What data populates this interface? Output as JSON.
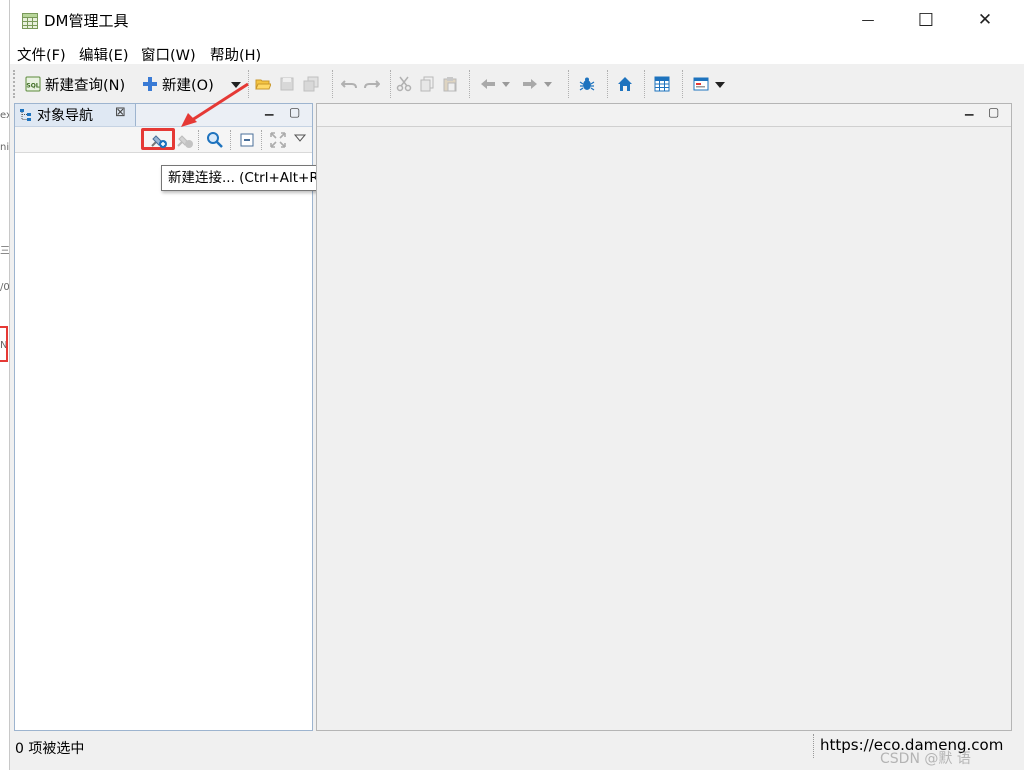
{
  "window": {
    "title": "DM管理工具",
    "controls": {
      "minimize": "—",
      "maximize": "☐",
      "close": "✕"
    }
  },
  "menu": [
    {
      "label": "文件(F)",
      "mnemonic": "F"
    },
    {
      "label": "编辑(E)",
      "mnemonic": "E"
    },
    {
      "label": "窗口(W)",
      "mnemonic": "W"
    },
    {
      "label": "帮助(H)",
      "mnemonic": "H"
    }
  ],
  "toolbar": {
    "new_query_label": "新建查询(N)",
    "new_label": "新建(O)",
    "icons": [
      "sql-icon",
      "plus-icon",
      "dropdown-icon",
      "open-folder-icon",
      "save-icon",
      "save-all-icon",
      "undo-icon",
      "redo-icon",
      "cut-icon",
      "copy-icon",
      "paste-icon",
      "back-arrow-icon",
      "forward-arrow-icon",
      "debug-bug-icon",
      "home-icon",
      "table-grid-icon",
      "window-layout-icon"
    ]
  },
  "navigator": {
    "tab_label": "对象导航",
    "tab_close": "⊠",
    "toolbar_icons": [
      "new-connection-icon",
      "disconnect-icon",
      "search-icon",
      "collapse-all-icon",
      "expand-icon",
      "view-menu-icon"
    ],
    "tooltip": "新建连接... (Ctrl+Alt+R)"
  },
  "status": {
    "left_text": "0 项被选中",
    "right_text": "https://eco.dameng.com"
  },
  "watermark": "CSDN @默 语",
  "background_marks": [
    "ex",
    "ni",
    "三",
    "/0",
    "N"
  ],
  "colors": {
    "accent": "#3a7bd5",
    "highlight_red": "#e53935",
    "panel_border": "#9db4cf",
    "home_blue": "#1e73be"
  }
}
